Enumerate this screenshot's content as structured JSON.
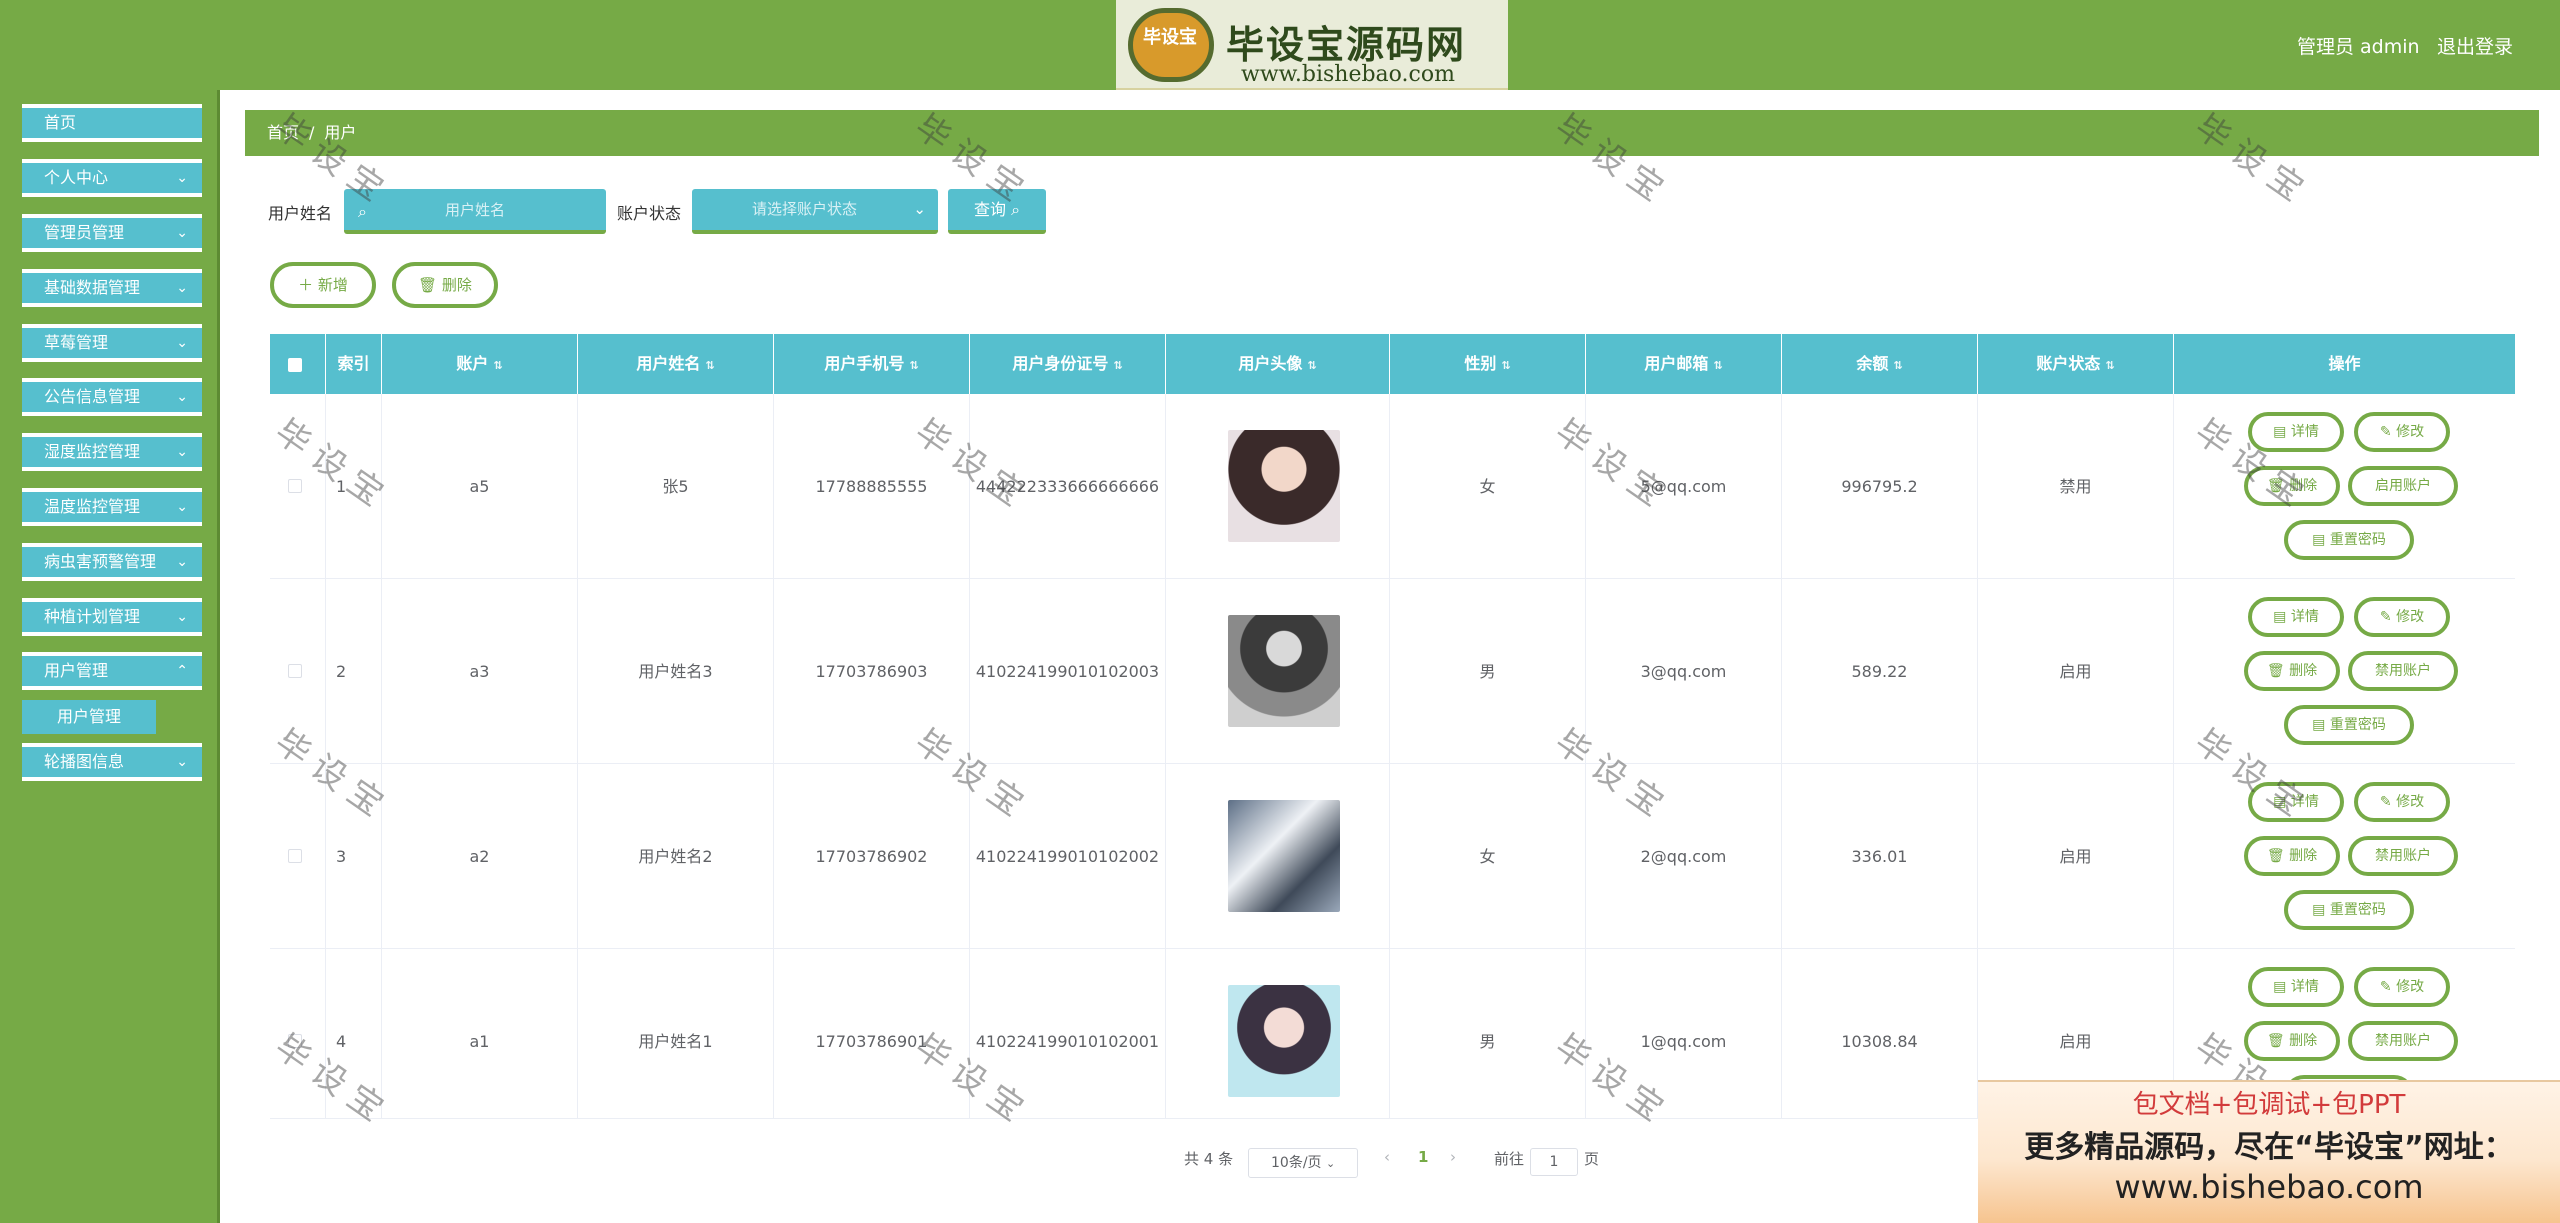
{
  "header": {
    "logo_badge": "毕设宝",
    "logo_title": "毕设宝源码网",
    "logo_url": "www.bishebao.com",
    "admin_label": "管理员 admin",
    "logout_label": "退出登录"
  },
  "sidebar": {
    "items": [
      {
        "label": "首页"
      },
      {
        "label": "个人中心"
      },
      {
        "label": "管理员管理"
      },
      {
        "label": "基础数据管理"
      },
      {
        "label": "草莓管理"
      },
      {
        "label": "公告信息管理"
      },
      {
        "label": "湿度监控管理"
      },
      {
        "label": "温度监控管理"
      },
      {
        "label": "病虫害预警管理"
      },
      {
        "label": "种植计划管理"
      },
      {
        "label": "用户管理"
      },
      {
        "label": "轮播图信息"
      }
    ],
    "sub_item": "用户管理"
  },
  "breadcrumb": {
    "home": "首页",
    "separator": "/",
    "current": "用户"
  },
  "search": {
    "name_label": "用户姓名",
    "name_placeholder": "用户姓名",
    "status_label": "账户状态",
    "status_placeholder": "请选择账户状态",
    "query_label": "查询"
  },
  "toolbar": {
    "add_label": "新增",
    "delete_label": "删除"
  },
  "table": {
    "columns": [
      "索引",
      "账户",
      "用户姓名",
      "用户手机号",
      "用户身份证号",
      "用户头像",
      "性别",
      "用户邮箱",
      "余额",
      "账户状态",
      "操作"
    ],
    "rows": [
      {
        "index": "1",
        "account": "a5",
        "name": "张5",
        "phone": "17788885555",
        "id_card": "444222333666666666",
        "gender": "女",
        "email": "5@qq.com",
        "balance": "996795.2",
        "status": "禁用",
        "toggle_label": "启用账户"
      },
      {
        "index": "2",
        "account": "a3",
        "name": "用户姓名3",
        "phone": "17703786903",
        "id_card": "410224199010102003",
        "gender": "男",
        "email": "3@qq.com",
        "balance": "589.22",
        "status": "启用",
        "toggle_label": "禁用账户"
      },
      {
        "index": "3",
        "account": "a2",
        "name": "用户姓名2",
        "phone": "17703786902",
        "id_card": "410224199010102002",
        "gender": "女",
        "email": "2@qq.com",
        "balance": "336.01",
        "status": "启用",
        "toggle_label": "禁用账户"
      },
      {
        "index": "4",
        "account": "a1",
        "name": "用户姓名1",
        "phone": "17703786901",
        "id_card": "410224199010102001",
        "gender": "男",
        "email": "1@qq.com",
        "balance": "10308.84",
        "status": "启用",
        "toggle_label": "禁用账户"
      }
    ],
    "actions": {
      "detail": "详情",
      "edit": "修改",
      "delete": "删除",
      "reset_password": "重置密码"
    }
  },
  "pagination": {
    "total_text": "共 4 条",
    "page_size": "10条/页",
    "current_page": "1",
    "goto_label": "前往",
    "goto_value": "1",
    "page_suffix": "页"
  },
  "watermark_text": "毕设宝",
  "promo": {
    "top": "包文档+包调试+包PPT",
    "middle": "更多精品源码，尽在“毕设宝”网址：",
    "url": "www.bishebao.com"
  }
}
